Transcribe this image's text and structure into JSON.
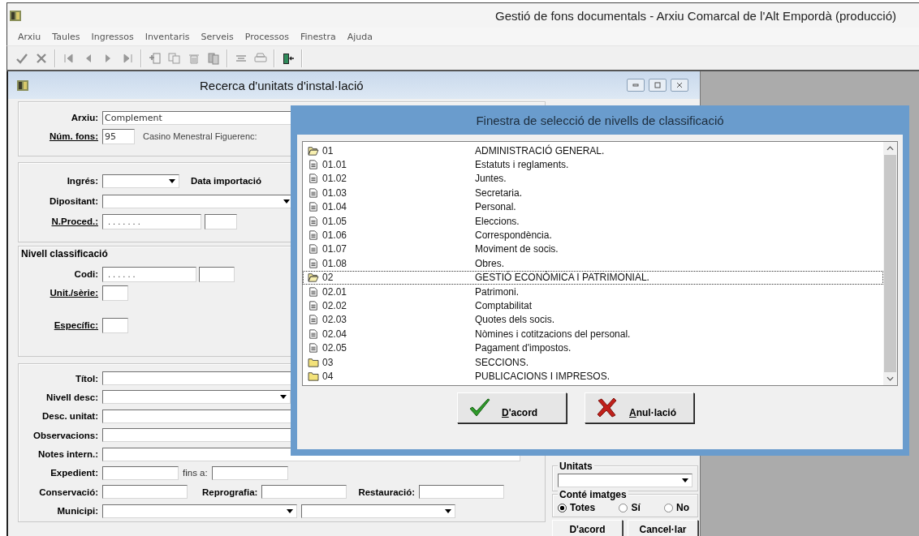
{
  "app": {
    "title": "Gestió de fons documentals - Arxiu Comarcal de l'Alt Empordà (producció)"
  },
  "menu": [
    "Arxiu",
    "Taules",
    "Ingressos",
    "Inventaris",
    "Serveis",
    "Processos",
    "Finestra",
    "Ajuda"
  ],
  "search": {
    "title": "Recerca d'unitats d'instal·lació",
    "arxiu": {
      "label": "Arxiu:",
      "value": "Complement"
    },
    "num_fons": {
      "label": "Núm. fons:",
      "value": "95",
      "description": "Casino Menestral Figuerenc:"
    },
    "ingres": {
      "label": "Ingrés:"
    },
    "data_importacio": {
      "label": "Data importació"
    },
    "dipositant": {
      "label": "Dipositant:"
    },
    "n_proced": {
      "label": "N.Proced.:",
      "value": ". . . . . . ."
    },
    "nivell": {
      "title": "Nivell classificació",
      "codi": {
        "label": "Codi:",
        "value": ". . . . . ."
      },
      "unit_serie": {
        "label": "Unit./sèrie:"
      },
      "especific": {
        "label": "Específic:"
      }
    },
    "titol": {
      "label": "Títol:"
    },
    "nivell_desc": {
      "label": "Nivell desc:"
    },
    "desc_unitat": {
      "label": "Desc. unitat:"
    },
    "observacions": {
      "label": "Observacions:"
    },
    "notes_intern": {
      "label": "Notes intern.:"
    },
    "expedient": {
      "label": "Expedient:"
    },
    "fins_a": {
      "label": "fins a:"
    },
    "conservacio": {
      "label": "Conservació:"
    },
    "reprografia": {
      "label": "Reprografia:"
    },
    "restauracio": {
      "label": "Restauració:"
    },
    "municipi": {
      "label": "Municipi:"
    },
    "unitats": {
      "label": "Unitats"
    },
    "conte_imatges": {
      "label": "Conté imatges",
      "options": [
        {
          "label": "Totes",
          "selected": true
        },
        {
          "label": "Sí",
          "selected": false
        },
        {
          "label": "No",
          "selected": false
        }
      ]
    },
    "buttons": [
      "D'acord",
      "Cancel·lar"
    ]
  },
  "dialog": {
    "title": "Finestra de selecció de nivells de classificació",
    "items": [
      {
        "kind": "folder-open",
        "code": "01",
        "name": "ADMINISTRACIÓ GENERAL.",
        "selected": false
      },
      {
        "kind": "document",
        "code": "01.01",
        "name": "Estatuts i reglaments.",
        "selected": false
      },
      {
        "kind": "document",
        "code": "01.02",
        "name": "Juntes.",
        "selected": false
      },
      {
        "kind": "document",
        "code": "01.03",
        "name": "Secretaria.",
        "selected": false
      },
      {
        "kind": "document",
        "code": "01.04",
        "name": "Personal.",
        "selected": false
      },
      {
        "kind": "document",
        "code": "01.05",
        "name": "Eleccions.",
        "selected": false
      },
      {
        "kind": "document",
        "code": "01.06",
        "name": "Correspondència.",
        "selected": false
      },
      {
        "kind": "document",
        "code": "01.07",
        "name": "Moviment de socis.",
        "selected": false
      },
      {
        "kind": "document",
        "code": "01.08",
        "name": "Obres.",
        "selected": false
      },
      {
        "kind": "folder-open",
        "code": "02",
        "name": "GESTIÓ ECONÒMICA I PATRIMONIAL.",
        "selected": true
      },
      {
        "kind": "document",
        "code": "02.01",
        "name": "Patrimoni.",
        "selected": false
      },
      {
        "kind": "document",
        "code": "02.02",
        "name": "Comptabilitat",
        "selected": false
      },
      {
        "kind": "document",
        "code": "02.03",
        "name": "Quotes dels socis.",
        "selected": false
      },
      {
        "kind": "document",
        "code": "02.04",
        "name": "Nòmines i cotitzacions del personal.",
        "selected": false
      },
      {
        "kind": "document",
        "code": "02.05",
        "name": "Pagament d'impostos.",
        "selected": false
      },
      {
        "kind": "folder",
        "code": "03",
        "name": "SECCIONS.",
        "selected": false
      },
      {
        "kind": "folder",
        "code": "04",
        "name": "PUBLICACIONS I IMPRESOS.",
        "selected": false
      }
    ],
    "buttons": [
      {
        "kind": "ok",
        "label": "D'acord"
      },
      {
        "kind": "cancel",
        "label": "Anul·lació"
      }
    ]
  }
}
